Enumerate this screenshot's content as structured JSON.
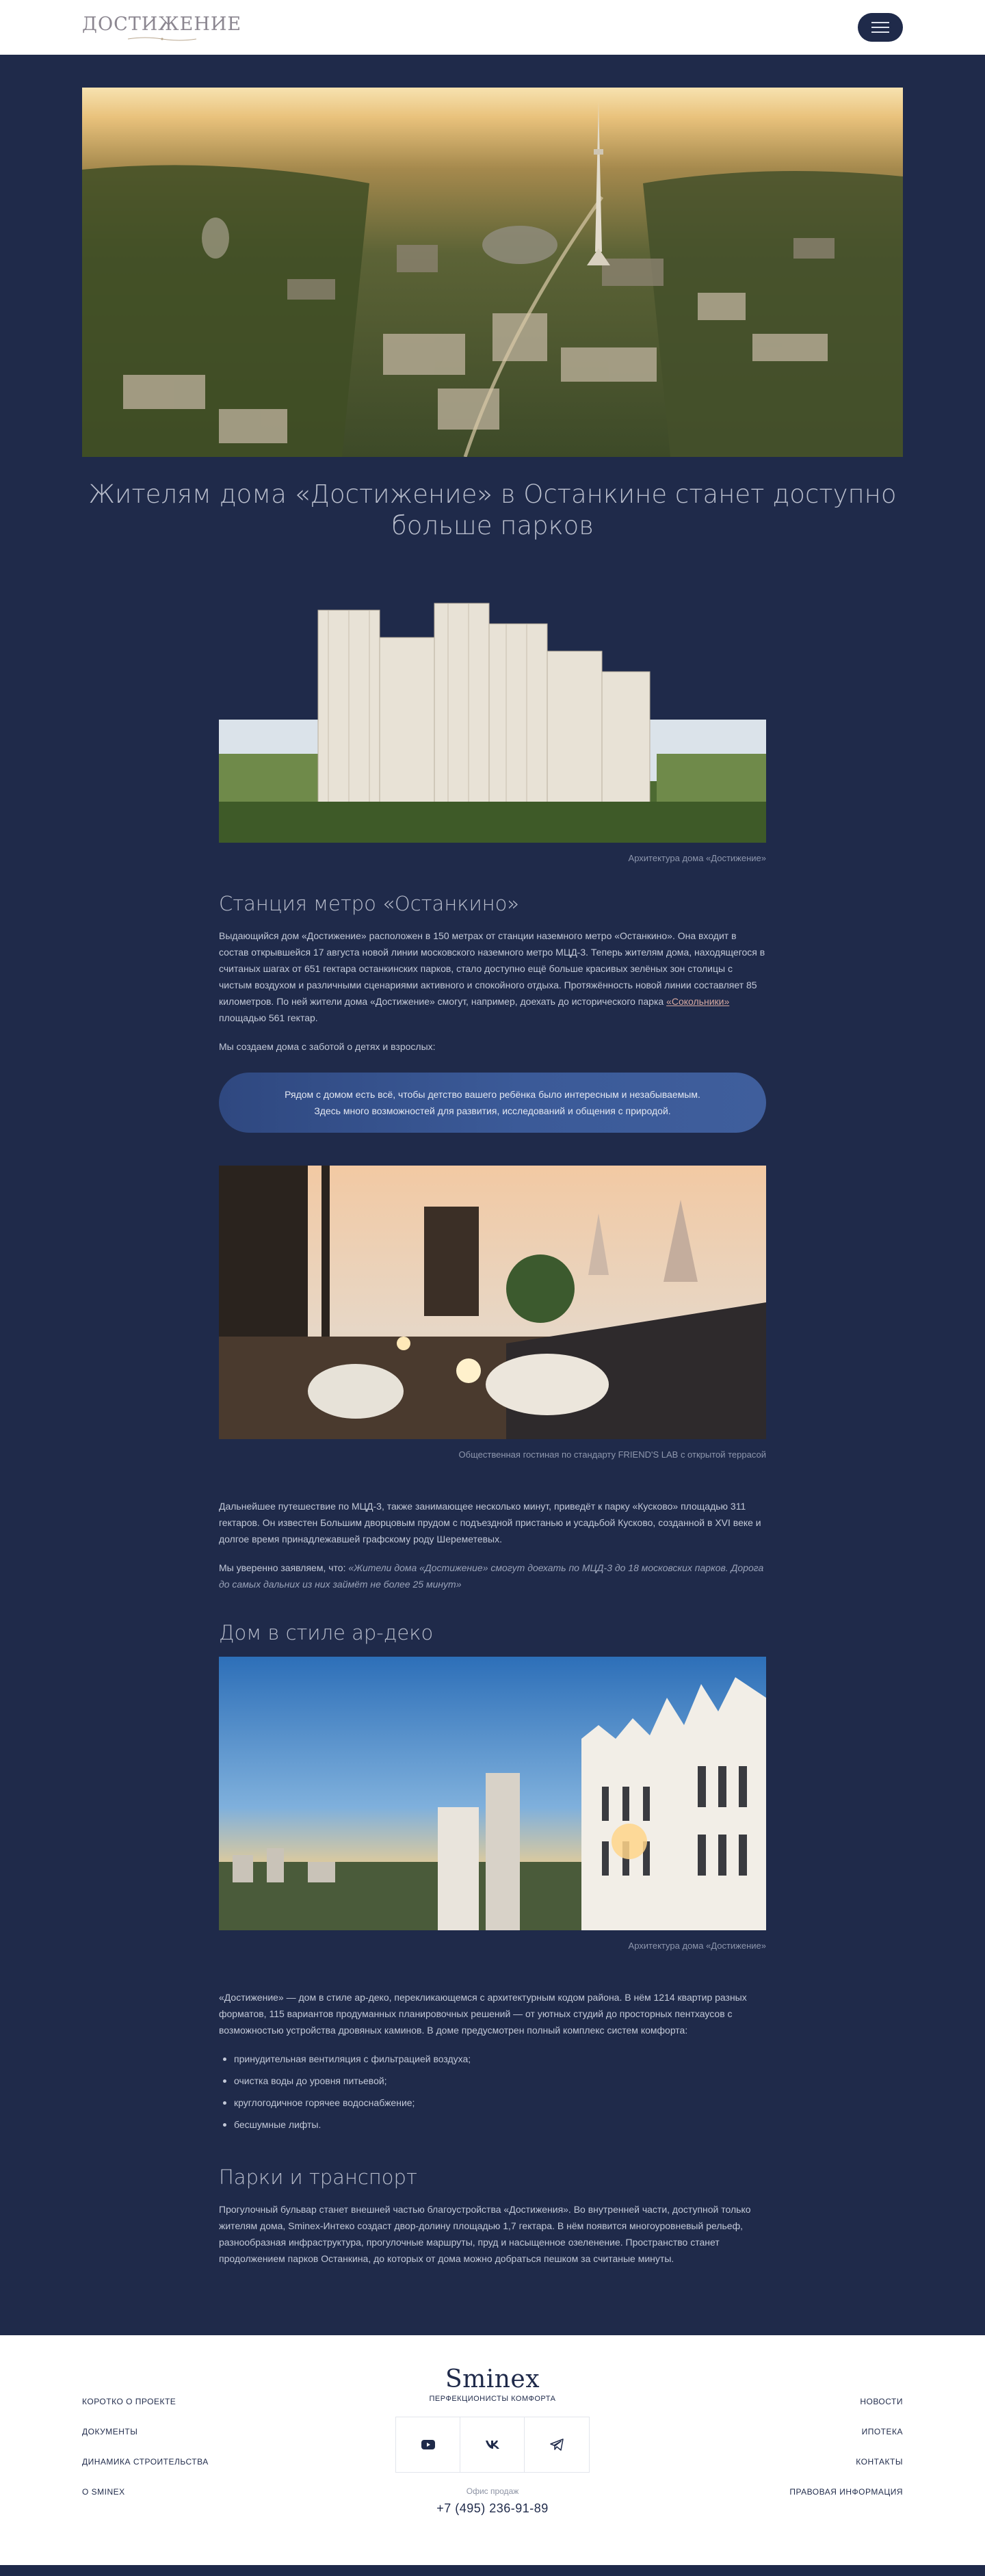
{
  "header": {
    "logo_text": "ДОСТИЖЕНИЕ",
    "menu_icon": "hamburger-icon"
  },
  "article": {
    "title": "Жителям дома «Достижение» в Останкине станет доступно больше парков",
    "figure1_caption": "Архитектура дома «Достижение»",
    "section1_heading": "Станция метро «Останкино»",
    "p1_before_link": "Выдающийся дом «Достижение» расположен в 150 метрах от станции наземного метро «Останкино». Она входит в состав открывшейся 17 августа новой линии московского наземного метро МЦД-3. Теперь жителям дома, находящегося в считаных шагах от 651 гектара останкинских парков, стало доступно ещё больше красивых зелёных зон столицы с чистым воздухом и различными сценариями активного и спокойного отдыха. Протяжённость новой линии составляет 85 километров. По ней жители дома «Достижение» смогут, например, доехать до исторического парка ",
    "p1_link": "«Сокольники»",
    "p1_after_link": " площадью 561 гектар.",
    "p2": "Мы создаем дома с заботой о детях и взрослых:",
    "callout_line1": "Рядом с домом есть всё, чтобы детство вашего ребёнка было интересным и незабываемым.",
    "callout_line2": "Здесь много возможностей для развития, исследований и общения с природой.",
    "figure2_caption": "Общественная гостиная по стандарту FRIEND'S LAB с открытой террасой",
    "p3": "Дальнейшее путешествие по МЦД-3, также занимающее несколько минут, приведёт к парку «Кусково» площадью 311 гектаров. Он известен Большим дворцовым прудом с подъездной пристанью и усадьбой Кусково, созданной в XVI веке и долгое время принадлежавшей графскому роду Шереметевых.",
    "p4_lead": "Мы уверенно заявляем, что: ",
    "p4_italic": "«Жители дома «Достижение» смогут доехать по МЦД-3 до 18 московских парков. Дорога до самых дальних из них займёт не более 25 минут»",
    "section2_heading": "Дом в стиле ар-деко",
    "figure3_caption": "Архитектура дома «Достижение»",
    "p5": "«Достижение» — дом в стиле ар-деко, перекликающемся с архитектурным кодом района. В нём 1214 квартир разных форматов, 115 вариантов продуманных планировочных решений — от уютных студий до просторных пентхаусов с возможностью устройства дровяных каминов. В доме предусмотрен полный комплекс систем комфорта:",
    "list": [
      "принудительная вентиляция с фильтрацией воздуха;",
      "очистка воды до уровня питьевой;",
      "круглогодичное горячее водоснабжение;",
      "бесшумные лифты."
    ],
    "section3_heading": "Парки и транспорт",
    "p6": "Прогулочный бульвар станет внешней частью благоустройства «Достижения». Во внутренней части, доступной только жителям дома, Sminex-Интеко создаст двор-долину площадью 1,7 гектара. В нём появится многоуровневый рельеф, разнообразная инфраструктура, прогулочные маршруты, пруд и насыщенное озеленение. Пространство станет продолжением парков Останкина, до которых от дома можно добраться пешком за считаные минуты."
  },
  "footer": {
    "left_links": [
      "КОРОТКО О ПРОЕКТЕ",
      "ДОКУМЕНТЫ",
      "ДИНАМИКА СТРОИТЕЛЬСТВА",
      "О SMINEX"
    ],
    "right_links": [
      "НОВОСТИ",
      "ИПОТЕКА",
      "КОНТАКТЫ",
      "ПРАВОВАЯ ИНФОРМАЦИЯ"
    ],
    "brand": "Sminex",
    "brand_sub": "ПЕРФЕКЦИОНИСТЫ КОМФОРТА",
    "socials": [
      "youtube-icon",
      "vk-icon",
      "telegram-icon"
    ],
    "office_label": "Офис продаж",
    "phone": "+7 (495) 236-91-89"
  },
  "colors": {
    "page_bg": "#1f2a4a",
    "callout_bg": "#3b5a98",
    "link": "#d7a9a1"
  }
}
